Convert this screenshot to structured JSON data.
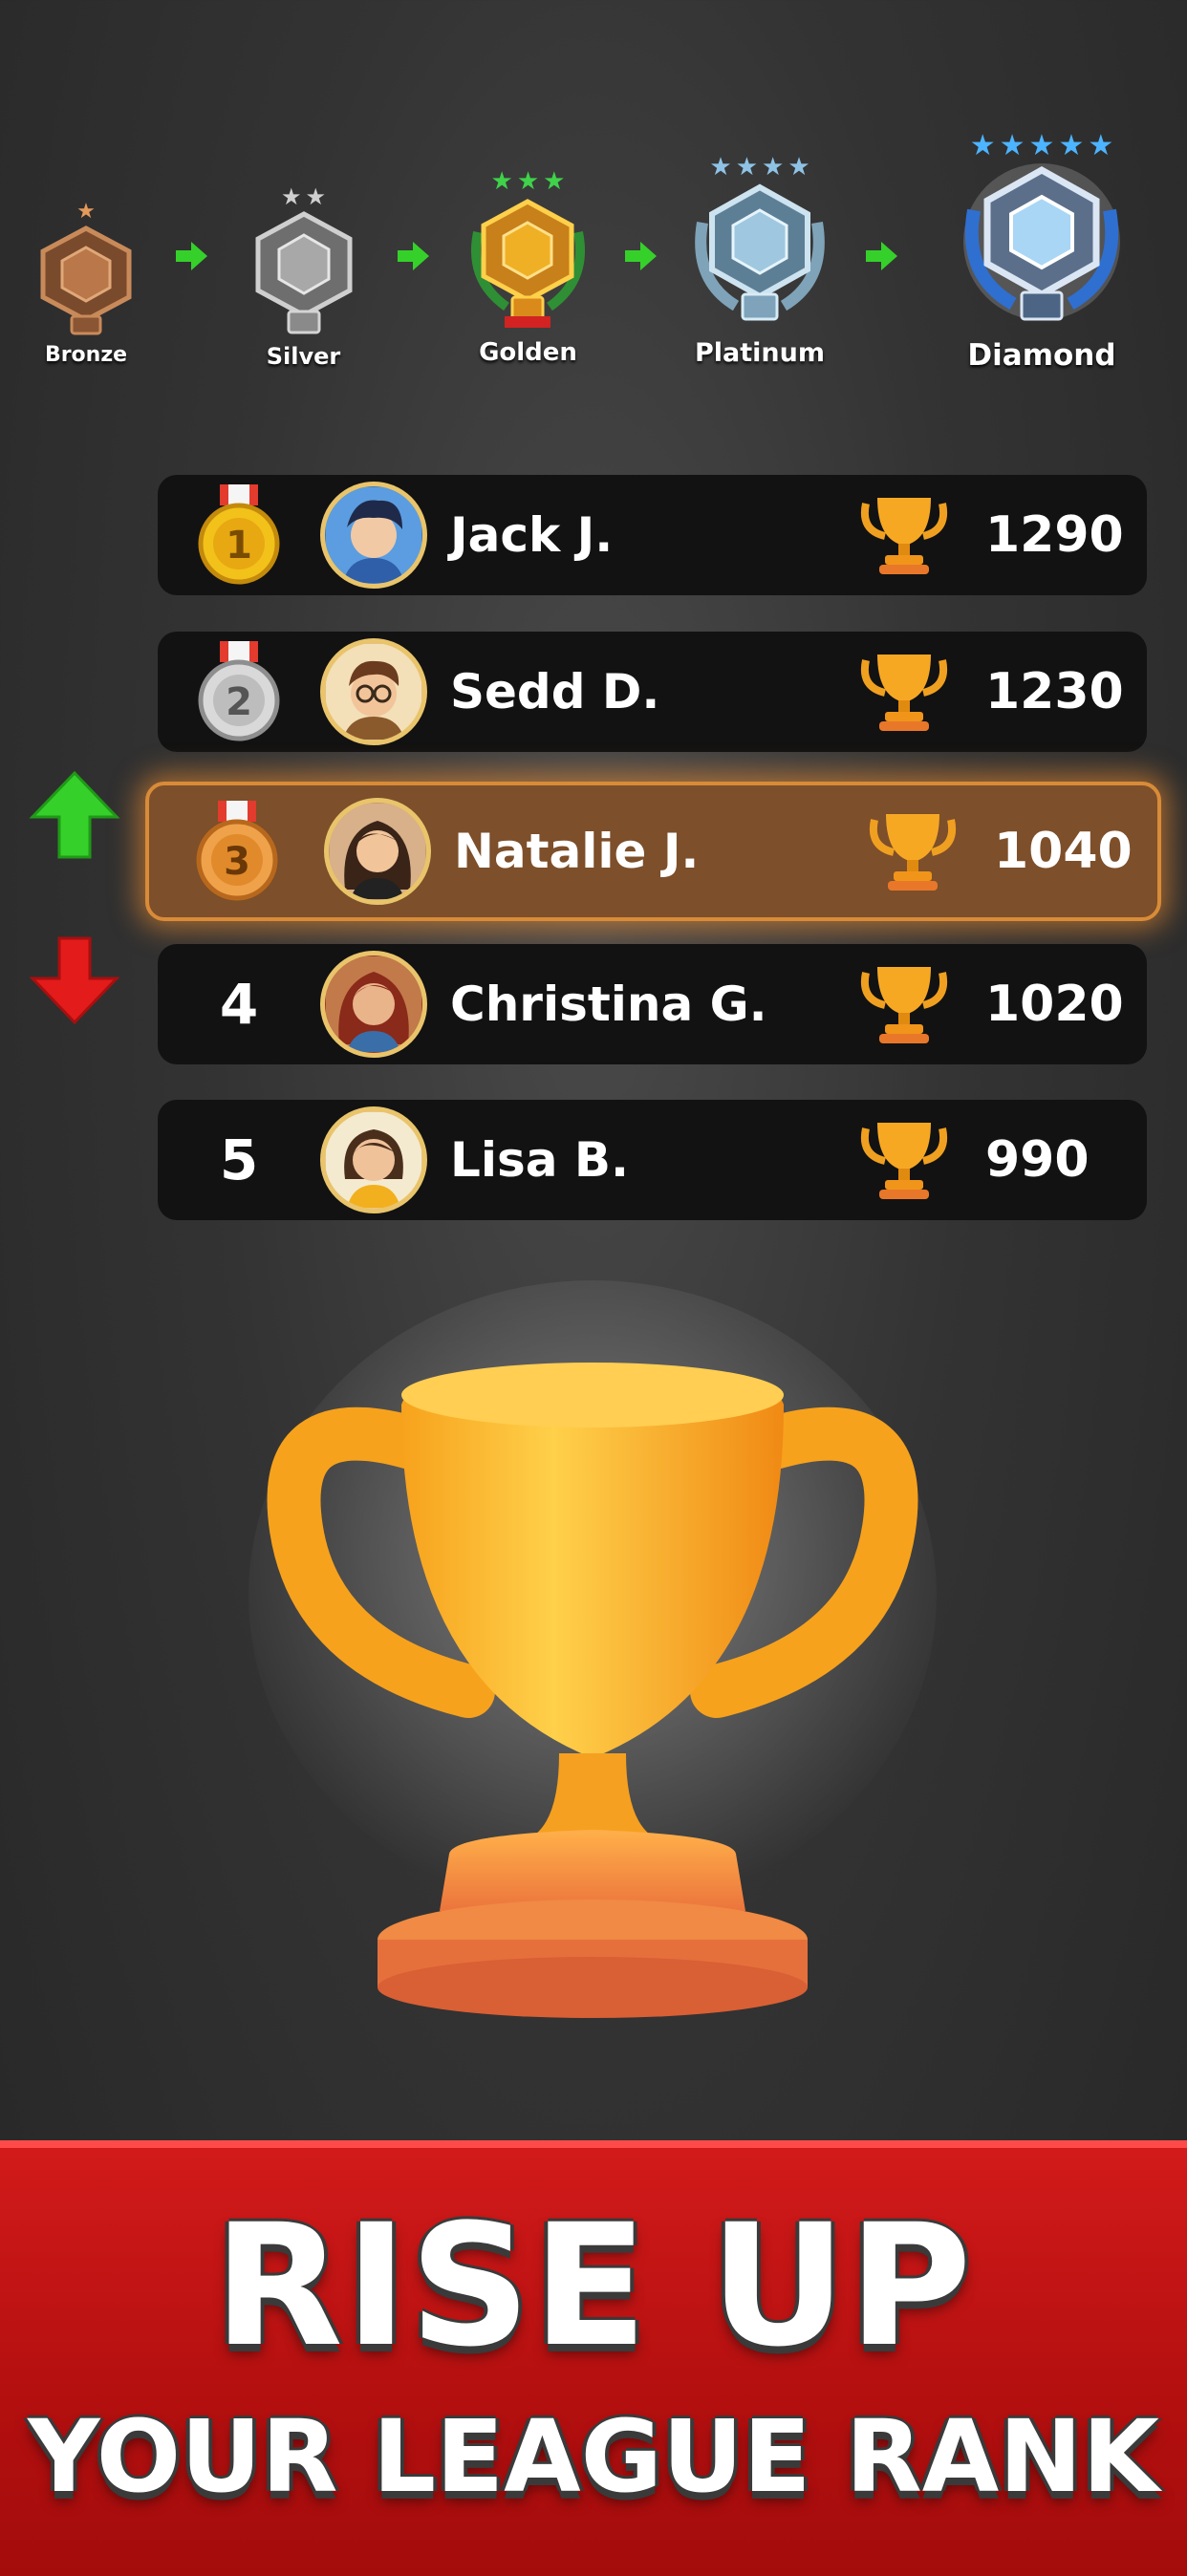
{
  "tiers": [
    {
      "name": "Bronze",
      "stars": 1,
      "color": "#a8673e",
      "star_color": "#e39a5a"
    },
    {
      "name": "Silver",
      "stars": 2,
      "color": "#9c9c9c",
      "star_color": "#cfcfcf"
    },
    {
      "name": "Golden",
      "stars": 3,
      "color": "#e6a21a",
      "star_color": "#3fd24a"
    },
    {
      "name": "Platinum",
      "stars": 4,
      "color": "#8fb6cf",
      "star_color": "#8fc3e6"
    },
    {
      "name": "Diamond",
      "stars": 5,
      "color": "#4a86d6",
      "star_color": "#4db4ff"
    }
  ],
  "leaderboard": [
    {
      "rank": "1",
      "name": "Jack J.",
      "score": "1290",
      "medal": "gold"
    },
    {
      "rank": "2",
      "name": "Sedd D.",
      "score": "1230",
      "medal": "silver"
    },
    {
      "rank": "3",
      "name": "Natalie J.",
      "score": "1040",
      "medal": "bronze",
      "highlight": true,
      "movement": "up"
    },
    {
      "rank": "4",
      "name": "Christina G.",
      "score": "1020",
      "movement": "down"
    },
    {
      "rank": "5",
      "name": "Lisa B.",
      "score": "990"
    }
  ],
  "banner": {
    "line1": "RISE UP",
    "line2": "YOUR LEAGUE RANK"
  },
  "colors": {
    "accent_green": "#35d12a",
    "accent_red": "#e31b1b",
    "trophy_gold": "#f5a623",
    "highlight_row": "#7d4f2a"
  },
  "icons": {
    "tier_arrow": "arrow-right-icon",
    "rank_up": "arrow-up-icon",
    "rank_down": "arrow-down-icon",
    "score": "trophy-icon"
  }
}
